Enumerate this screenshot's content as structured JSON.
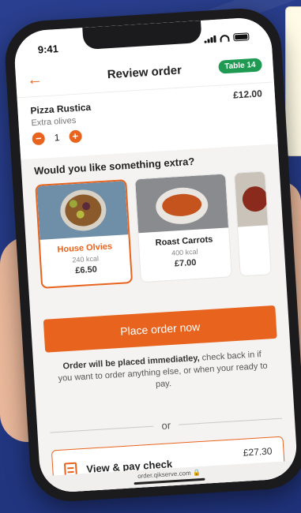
{
  "status": {
    "time": "9:41"
  },
  "header": {
    "title": "Review order",
    "table_badge": "Table 14"
  },
  "order_item": {
    "name": "Pizza Rustica",
    "modifier": "Extra olives",
    "quantity": "1",
    "price": "£12.00"
  },
  "upsell": {
    "heading": "Would you like something extra?",
    "items": [
      {
        "name": "House Olvies",
        "kcal": "240 kcal",
        "price": "£6.50"
      },
      {
        "name": "Roast Carrots",
        "kcal": "400 kcal",
        "price": "£7.00"
      }
    ]
  },
  "actions": {
    "place_order": "Place order now",
    "notice_bold": "Order will be placed immediatley,",
    "notice_rest": "check back in if you want to order anything else, or when your ready to pay.",
    "or": "or",
    "view_pay_label": "View & pay check",
    "view_pay_total": "£27.30"
  },
  "browser": {
    "url": "order.qikserve.com"
  },
  "colors": {
    "accent": "#e8631e",
    "badge": "#1e9a52"
  }
}
